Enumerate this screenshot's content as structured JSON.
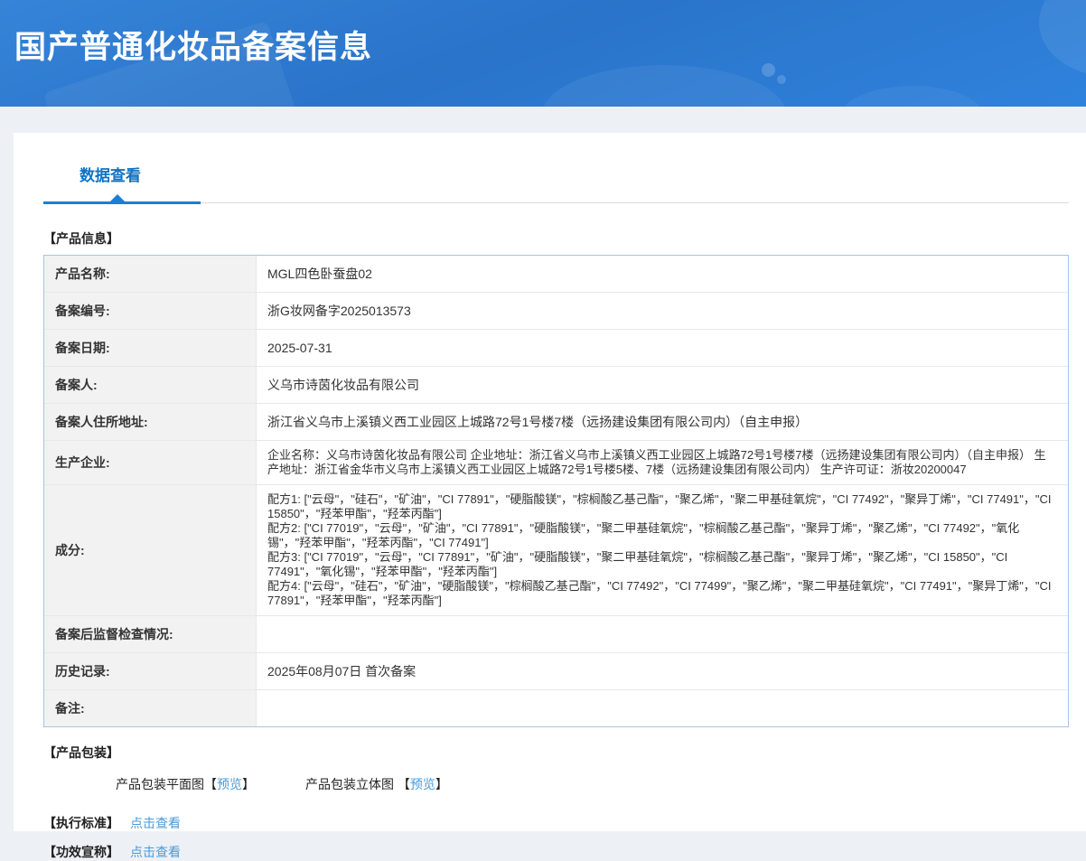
{
  "banner": {
    "title": "国产普通化妆品备案信息"
  },
  "tab": {
    "label": "数据查看"
  },
  "product_info": {
    "section_title": "【产品信息】",
    "rows": [
      {
        "label": "产品名称:",
        "value": "MGL四色卧蚕盘02"
      },
      {
        "label": "备案编号:",
        "value": "浙G妆网备字2025013573"
      },
      {
        "label": "备案日期:",
        "value": "2025-07-31"
      },
      {
        "label": "备案人:",
        "value": "义乌市诗茵化妆品有限公司"
      },
      {
        "label": "备案人住所地址:",
        "value": "浙江省义乌市上溪镇义西工业园区上城路72号1号楼7楼（远扬建设集团有限公司内）（自主申报）"
      },
      {
        "label": "生产企业:",
        "value": "企业名称：义乌市诗茵化妆品有限公司 企业地址：浙江省义乌市上溪镇义西工业园区上城路72号1号楼7楼（远扬建设集团有限公司内）（自主申报） 生产地址：浙江省金华市义乌市上溪镇义西工业园区上城路72号1号楼5楼、7楼（远扬建设集团有限公司内） 生产许可证：浙妆20200047"
      },
      {
        "label": "成分:",
        "value": "配方1: [\"云母\"，\"硅石\"，\"矿油\"，\"CI 77891\"，\"硬脂酸镁\"，\"棕榈酸乙基己酯\"，\"聚乙烯\"，\"聚二甲基硅氧烷\"，\"CI 77492\"，\"聚异丁烯\"，\"CI 77491\"，\"CI 15850\"，\"羟苯甲酯\"，\"羟苯丙酯\"]\n配方2: [\"CI 77019\"，\"云母\"，\"矿油\"，\"CI 77891\"，\"硬脂酸镁\"，\"聚二甲基硅氧烷\"，\"棕榈酸乙基己酯\"，\"聚异丁烯\"，\"聚乙烯\"，\"CI 77492\"，\"氧化锡\"，\"羟苯甲酯\"，\"羟苯丙酯\"，\"CI 77491\"]\n配方3: [\"CI 77019\"，\"云母\"，\"CI 77891\"，\"矿油\"，\"硬脂酸镁\"，\"聚二甲基硅氧烷\"，\"棕榈酸乙基己酯\"，\"聚异丁烯\"，\"聚乙烯\"，\"CI 15850\"，\"CI 77491\"，\"氧化锡\"，\"羟苯甲酯\"，\"羟苯丙酯\"]\n配方4: [\"云母\"，\"硅石\"，\"矿油\"，\"硬脂酸镁\"，\"棕榈酸乙基己酯\"，\"CI 77492\"，\"CI 77499\"，\"聚乙烯\"，\"聚二甲基硅氧烷\"，\"CI 77491\"，\"聚异丁烯\"，\"CI 77891\"，\"羟苯甲酯\"，\"羟苯丙酯\"]"
      },
      {
        "label": "备案后监督检查情况:",
        "value": ""
      },
      {
        "label": "历史记录:",
        "value": "2025年08月07日 首次备案"
      },
      {
        "label": "备注:",
        "value": ""
      }
    ]
  },
  "packaging": {
    "section_title": "【产品包装】",
    "items": [
      {
        "name": "产品包装平面图",
        "open": "【",
        "link": "预览",
        "close": "】"
      },
      {
        "name": "产品包装立体图 ",
        "open": "【",
        "link": "预览",
        "close": "】"
      }
    ]
  },
  "exec_standard": {
    "title": "【执行标准】",
    "link": "点击查看"
  },
  "efficacy_claim": {
    "title": "【功效宣称】",
    "link": "点击查看"
  },
  "colors": {
    "banner_blue": "#2e7bd2",
    "accent_blue": "#1a7fd6",
    "tab_text_blue": "#1273c2",
    "link_blue": "#4a9bd9",
    "label_cell_bg": "#f2f2f2",
    "table_border": "#a9c4e1",
    "page_bg": "#edf1f6"
  }
}
